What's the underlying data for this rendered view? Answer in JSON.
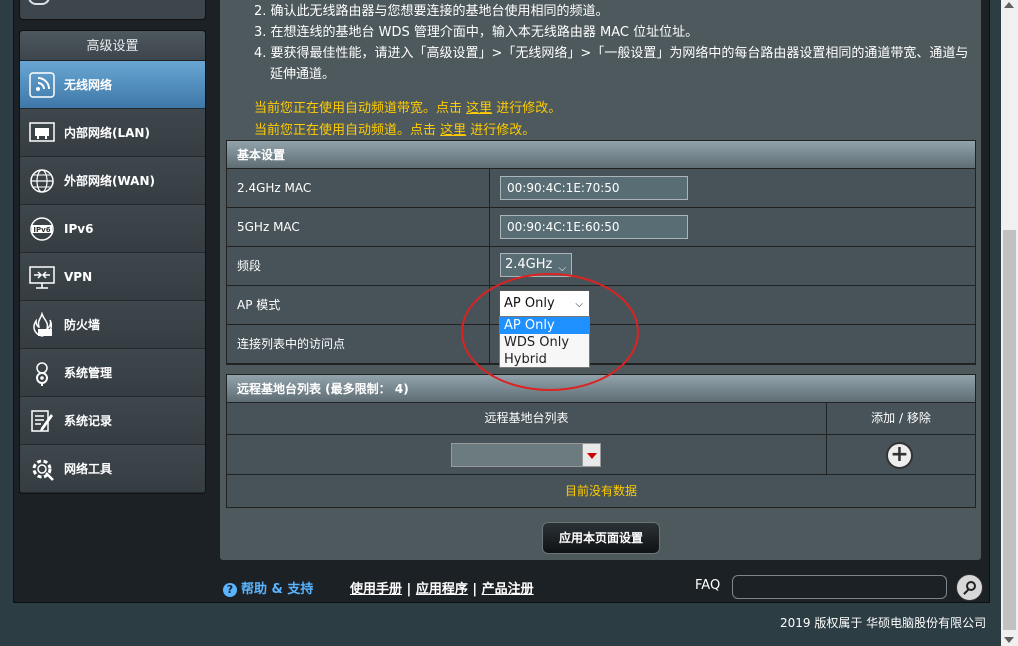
{
  "instructions": [
    "2. 确认此无线路由器与您想要连接的基地台使用相同的频道。",
    "3. 在想连线的基地台 WDS 管理介面中，输入本无线路由器 MAC 位址位址。",
    "4. 要获得最佳性能，请进入「高级设置」>「无线网络」>「一般设置」为网络中的每台路由器设置相同的通道带宽、通道与",
    "延伸通道。"
  ],
  "notices": {
    "bandwidth": {
      "prefix": "当前您正在使用自动频道带宽。点击 ",
      "link": "这里",
      "suffix": " 进行修改。"
    },
    "channel": {
      "prefix": "当前您正在使用自动频道。点击 ",
      "link": "这里",
      "suffix": " 进行修改。"
    }
  },
  "sidebar": {
    "group_title": "高级设置",
    "items": [
      {
        "label": "无线网络",
        "icon": "wireless-icon"
      },
      {
        "label": "内部网络(LAN)",
        "icon": "lan-icon"
      },
      {
        "label": "外部网络(WAN)",
        "icon": "globe-icon"
      },
      {
        "label": "IPv6",
        "icon": "ipv6-icon"
      },
      {
        "label": "VPN",
        "icon": "vpn-icon"
      },
      {
        "label": "防火墙",
        "icon": "firewall-icon"
      },
      {
        "label": "系统管理",
        "icon": "admin-icon"
      },
      {
        "label": "系统记录",
        "icon": "log-icon"
      },
      {
        "label": "网络工具",
        "icon": "tools-icon"
      }
    ]
  },
  "basic": {
    "title": "基本设置",
    "mac24_label": "2.4GHz MAC",
    "mac24_value": "00:90:4C:1E:70:50",
    "mac5_label": "5GHz MAC",
    "mac5_value": "00:90:4C:1E:60:50",
    "band_label": "频段",
    "band_value": "2.4GHz",
    "ap_mode_label": "AP 模式",
    "ap_mode_value": "AP Only",
    "ap_mode_options": [
      "AP Only",
      "WDS Only",
      "Hybrid"
    ],
    "ap_list_label": "连接列表中的访问点"
  },
  "remote": {
    "title": "远程基地台列表 (最多限制： 4)",
    "col_list": "远程基地台列表",
    "col_action": "添加 / 移除",
    "empty": "目前没有数据"
  },
  "apply_label": "应用本页面设置",
  "footer": {
    "help": "帮助 & 支持",
    "manual": "使用手册",
    "app": "应用程序",
    "register": "产品注册",
    "faq": "FAQ",
    "copyright": "2019 版权属于 华硕电脑股份有限公司"
  }
}
